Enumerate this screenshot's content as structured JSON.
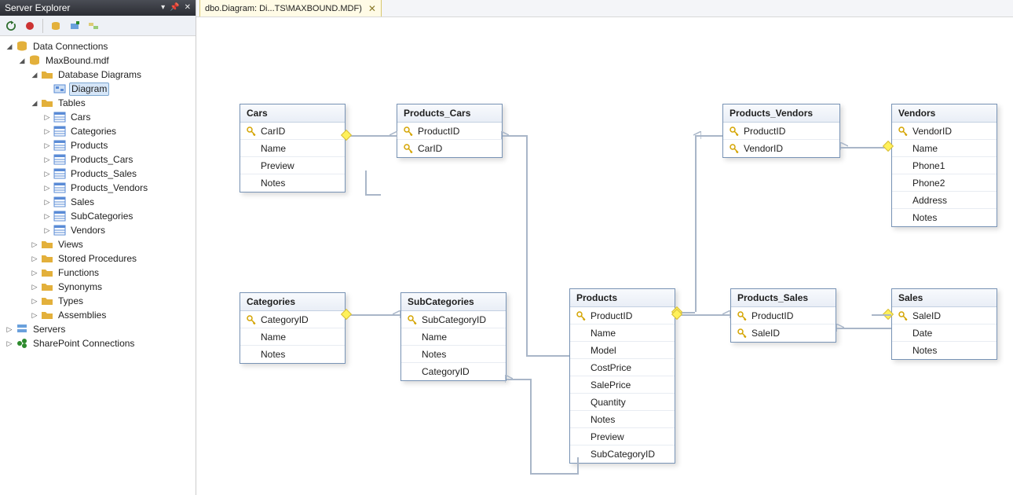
{
  "sidebar": {
    "title": "Server Explorer",
    "toolbar": [
      "refresh",
      "stop",
      "connect-db",
      "add-server",
      "link"
    ],
    "tree": {
      "root_label": "Data Connections",
      "db_label": "MaxBound.mdf",
      "diagrams_label": "Database Diagrams",
      "diagram_item": "Diagram",
      "tables_label": "Tables",
      "tables": [
        "Cars",
        "Categories",
        "Products",
        "Products_Cars",
        "Products_Sales",
        "Products_Vendors",
        "Sales",
        "SubCategories",
        "Vendors"
      ],
      "other_folders": [
        "Views",
        "Stored Procedures",
        "Functions",
        "Synonyms",
        "Types",
        "Assemblies"
      ],
      "servers_label": "Servers",
      "sharepoint_label": "SharePoint Connections"
    }
  },
  "tab": {
    "title": "dbo.Diagram: Di...TS\\MAXBOUND.MDF)"
  },
  "tables": {
    "Cars": {
      "title": "Cars",
      "cols": [
        [
          "CarID",
          true
        ],
        [
          "Name",
          false
        ],
        [
          "Preview",
          false
        ],
        [
          "Notes",
          false
        ]
      ]
    },
    "Products_Cars": {
      "title": "Products_Cars",
      "cols": [
        [
          "ProductID",
          true
        ],
        [
          "CarID",
          true
        ]
      ]
    },
    "Products_Vendors": {
      "title": "Products_Vendors",
      "cols": [
        [
          "ProductID",
          true
        ],
        [
          "VendorID",
          true
        ]
      ]
    },
    "Vendors": {
      "title": "Vendors",
      "cols": [
        [
          "VendorID",
          true
        ],
        [
          "Name",
          false
        ],
        [
          "Phone1",
          false
        ],
        [
          "Phone2",
          false
        ],
        [
          "Address",
          false
        ],
        [
          "Notes",
          false
        ]
      ]
    },
    "Categories": {
      "title": "Categories",
      "cols": [
        [
          "CategoryID",
          true
        ],
        [
          "Name",
          false
        ],
        [
          "Notes",
          false
        ]
      ]
    },
    "SubCategories": {
      "title": "SubCategories",
      "cols": [
        [
          "SubCategoryID",
          true
        ],
        [
          "Name",
          false
        ],
        [
          "Notes",
          false
        ],
        [
          "CategoryID",
          false
        ]
      ]
    },
    "Products": {
      "title": "Products",
      "cols": [
        [
          "ProductID",
          true
        ],
        [
          "Name",
          false
        ],
        [
          "Model",
          false
        ],
        [
          "CostPrice",
          false
        ],
        [
          "SalePrice",
          false
        ],
        [
          "Quantity",
          false
        ],
        [
          "Notes",
          false
        ],
        [
          "Preview",
          false
        ],
        [
          "SubCategoryID",
          false
        ]
      ]
    },
    "Products_Sales": {
      "title": "Products_Sales",
      "cols": [
        [
          "ProductID",
          true
        ],
        [
          "SaleID",
          true
        ]
      ]
    },
    "Sales": {
      "title": "Sales",
      "cols": [
        [
          "SaleID",
          true
        ],
        [
          "Date",
          false
        ],
        [
          "Notes",
          false
        ]
      ]
    }
  }
}
